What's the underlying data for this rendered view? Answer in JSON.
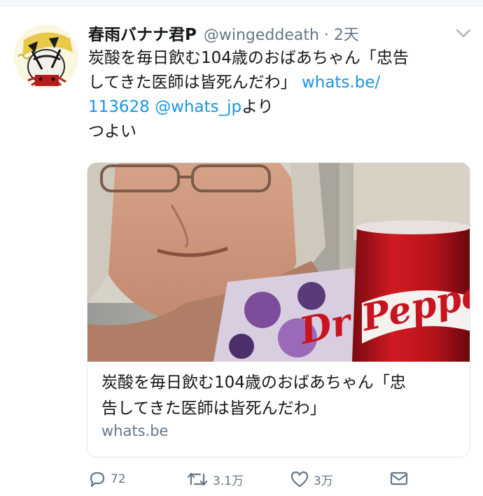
{
  "tweet": {
    "author_name": "春雨バナナ君P",
    "author_handle": "@wingeddeath",
    "timestamp": "2天",
    "text_line1": "炭酸を毎日飲む104歳のおばあちゃん「忠告",
    "text_line2_a": "してきた医師は皆死んだわ」",
    "text_line2_link": "whats.be/",
    "text_line3_link": "113628",
    "text_line3_mention": "@whats_jp",
    "text_line3_rest": "より",
    "text_line4": "つよい"
  },
  "card": {
    "image_text": "Dr Pepper",
    "title_line1": "炭酸を毎日飲む104歳のおばあちゃん「忠",
    "title_line2": "告してきた医師は皆死んだわ」",
    "domain": "whats.be"
  },
  "actions": {
    "reply_count": "72",
    "retweet_count": "3.1万",
    "like_count": "3万"
  },
  "icons": {
    "menu": "chevron-down-icon",
    "reply": "reply-icon",
    "retweet": "retweet-icon",
    "like": "heart-icon",
    "dm": "envelope-icon"
  },
  "colors": {
    "link": "#1b95e0",
    "secondary": "#657786",
    "border": "#e1e8ed",
    "can_red": "#c8141e"
  }
}
